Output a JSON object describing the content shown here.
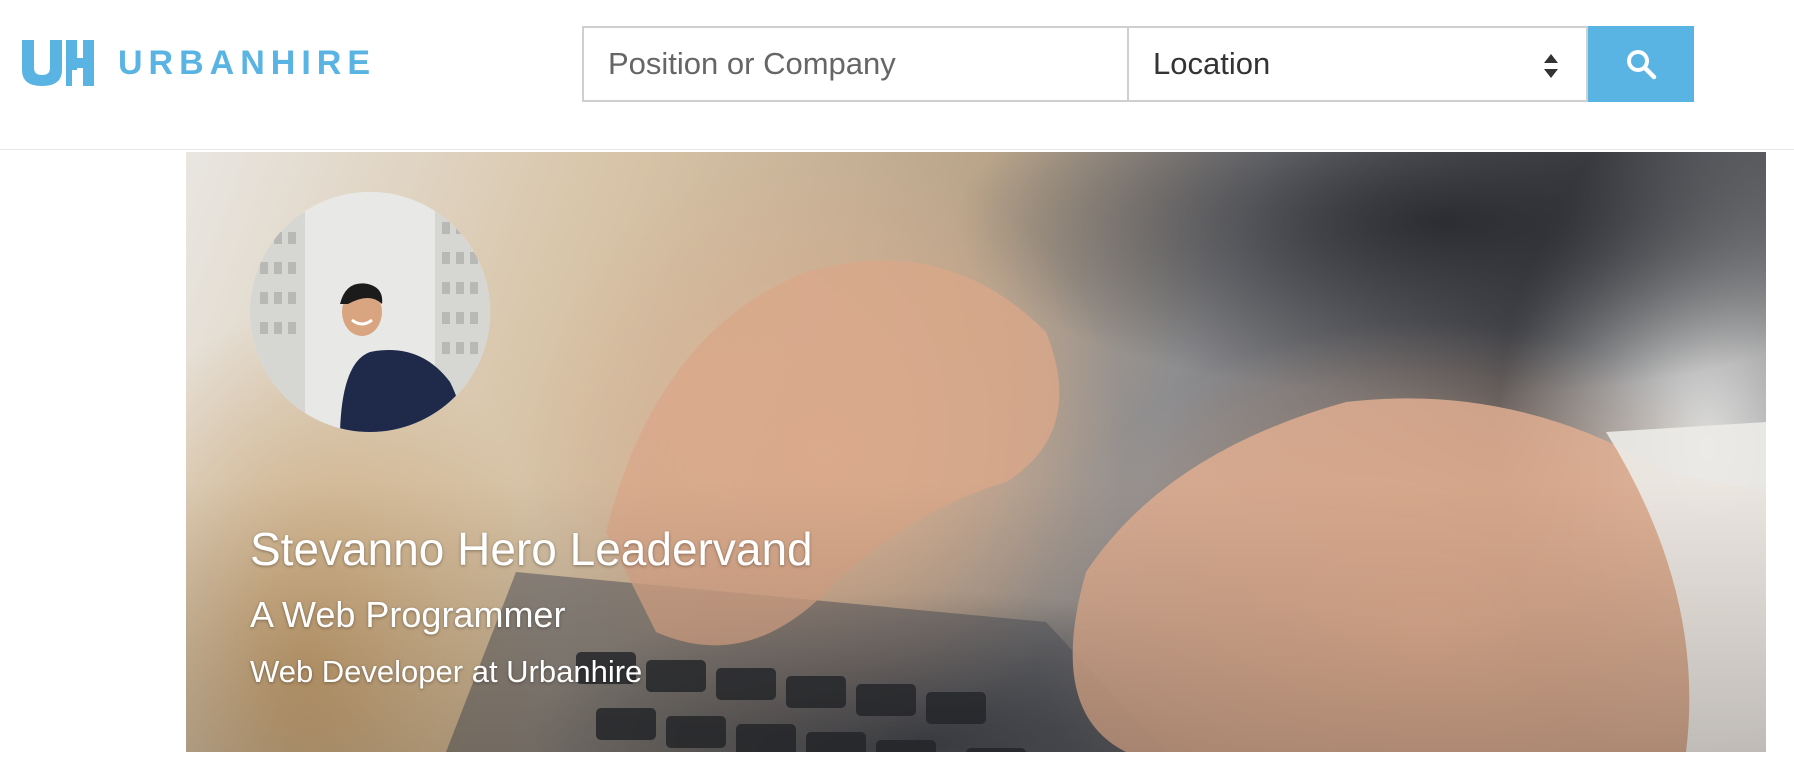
{
  "header": {
    "logo_mark": "UH",
    "brand_name": "URBANHIRE",
    "brand_color": "#5ab4e3"
  },
  "search": {
    "position_placeholder": "Position or Company",
    "position_value": "",
    "location_selected": "Location",
    "button_icon": "search-icon",
    "button_color": "#5ab4e3"
  },
  "profile": {
    "cover_image": "hands typing on laptop keyboard",
    "avatar": "profile photo",
    "name": "Stevanno Hero Leadervand",
    "headline": "A Web Programmer",
    "role": "Web Developer at Urbanhire"
  }
}
